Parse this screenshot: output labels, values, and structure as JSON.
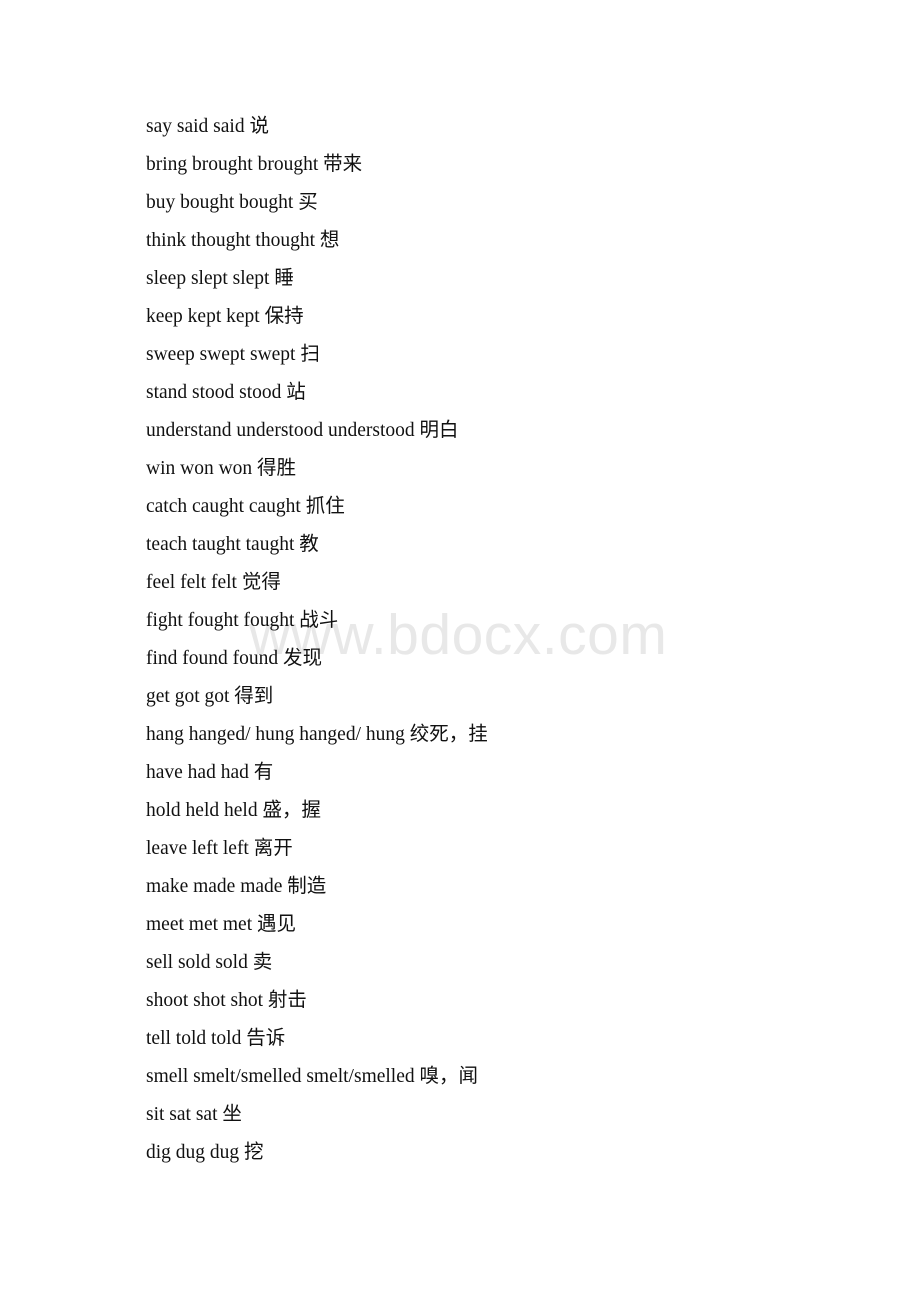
{
  "document": {
    "watermark": "www.bdocx.com",
    "background_color": "#ffffff",
    "text_color": "#111111",
    "watermark_color": "#e8e8e8"
  },
  "lines": [
    {
      "text": "say said said 说"
    },
    {
      "text": "bring brought brought 带来"
    },
    {
      "text": "buy bought bought 买"
    },
    {
      "text": "think thought thought 想"
    },
    {
      "text": "sleep slept slept 睡"
    },
    {
      "text": "keep kept kept 保持"
    },
    {
      "text": "sweep swept swept 扫"
    },
    {
      "text": "stand stood stood 站"
    },
    {
      "text": "understand understood understood 明白"
    },
    {
      "text": "win won won 得胜"
    },
    {
      "text": "catch caught caught 抓住"
    },
    {
      "text": "teach taught taught 教"
    },
    {
      "text": "feel felt felt 觉得"
    },
    {
      "text": "fight fought fought 战斗"
    },
    {
      "text": "find found found 发现"
    },
    {
      "text": "get got got 得到"
    },
    {
      "text": "hang hanged/ hung hanged/ hung 绞死，挂"
    },
    {
      "text": "have had had 有"
    },
    {
      "text": "hold held held 盛，握"
    },
    {
      "text": "leave left left 离开"
    },
    {
      "text": "make made made 制造"
    },
    {
      "text": "meet met met 遇见"
    },
    {
      "text": "sell sold sold 卖"
    },
    {
      "text": "shoot shot shot 射击"
    },
    {
      "text": "tell told told 告诉"
    },
    {
      "text": "smell smelt/smelled smelt/smelled 嗅，闻"
    },
    {
      "text": "sit sat sat 坐"
    },
    {
      "text": "dig dug dug 挖"
    }
  ]
}
